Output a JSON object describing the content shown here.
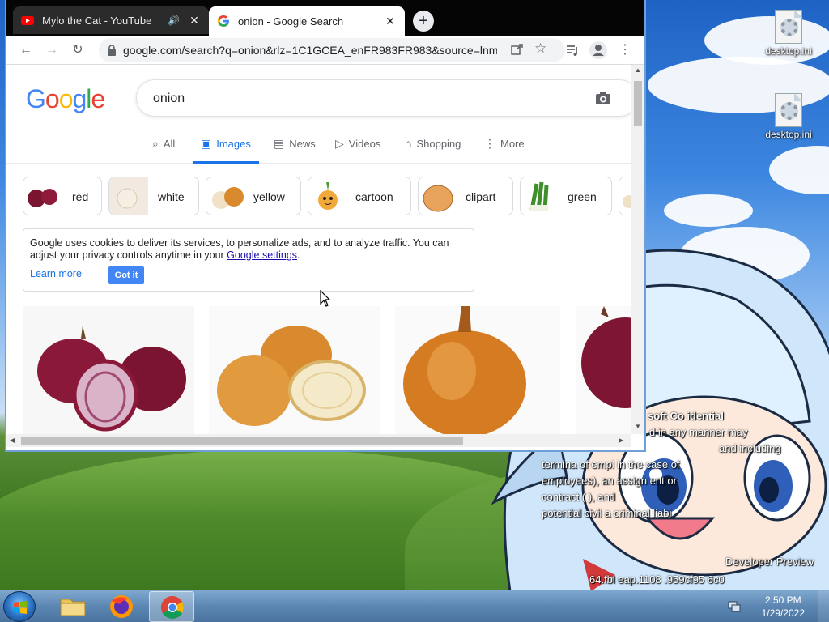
{
  "desktop": {
    "icons": [
      {
        "label": "desktop.ini"
      },
      {
        "label": "desktop.ini"
      }
    ],
    "watermark": {
      "line1": "soft Co  idential",
      "line2": "d  in any manner may",
      "line3": "and including",
      "line4": "termina   of empl    in the case of",
      "line5": "employees),             an assign   ent or",
      "line6": "contract (               ), and",
      "line7": "potential civil a      criminal liabi",
      "line8": "Developer Preview",
      "line9": "64.fbl      eap.1108                .959cf95      6c0"
    }
  },
  "browser": {
    "tabs": [
      {
        "title": "Mylo the Cat - YouTube",
        "favicon": "youtube-icon",
        "audio": true
      },
      {
        "title": "onion - Google Search",
        "favicon": "google-icon",
        "active": true
      }
    ],
    "url": "google.com/search?q=onion&rlz=1C1GCEA_enFR983FR983&source=lnm...",
    "search": {
      "logo_letters": [
        "G",
        "o",
        "o",
        "g",
        "l",
        "e"
      ],
      "query": "onion"
    },
    "nav_tabs": [
      {
        "label": "All",
        "icon": "search-icon"
      },
      {
        "label": "Images",
        "icon": "image-icon",
        "selected": true
      },
      {
        "label": "News",
        "icon": "news-icon"
      },
      {
        "label": "Videos",
        "icon": "play-icon"
      },
      {
        "label": "Shopping",
        "icon": "tag-icon"
      },
      {
        "label": "More",
        "icon": "more-vertical-icon"
      }
    ],
    "chips": [
      {
        "label": "red"
      },
      {
        "label": "white"
      },
      {
        "label": "yellow"
      },
      {
        "label": "cartoon"
      },
      {
        "label": "clipart"
      },
      {
        "label": "green"
      }
    ],
    "cookie_notice": {
      "text_before": "Google uses cookies to deliver its services, to personalize ads, and to analyze traffic. You can adjust your privacy controls anytime in your ",
      "link": "Google settings",
      "text_after": ".",
      "learn_more": "Learn more",
      "button": "Got it"
    }
  },
  "taskbar": {
    "clock_time": "2:50 PM",
    "clock_date": "1/29/2022"
  },
  "colors": {
    "accent": "#1a73e8",
    "tab_strip": "#050505",
    "taskbar": "#5d87b3"
  }
}
